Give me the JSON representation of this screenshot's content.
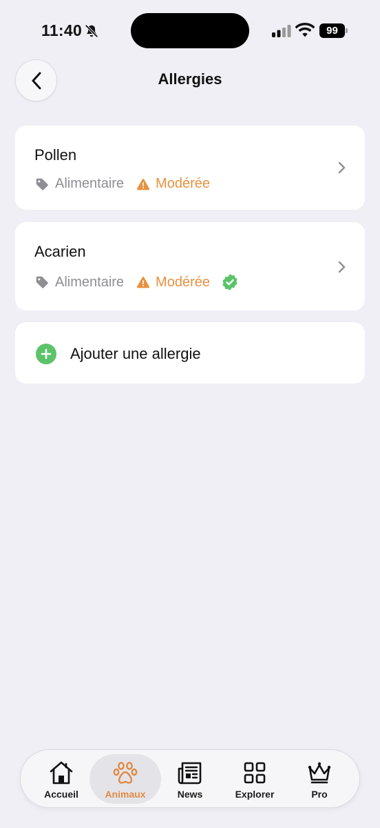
{
  "status_bar": {
    "time": "11:40",
    "battery": "99"
  },
  "header": {
    "title": "Allergies"
  },
  "allergies": [
    {
      "name": "Pollen",
      "type": "Alimentaire",
      "severity": "Modérée",
      "verified": false
    },
    {
      "name": "Acarien",
      "type": "Alimentaire",
      "severity": "Modérée",
      "verified": true
    }
  ],
  "add_action": {
    "label": "Ajouter une allergie"
  },
  "tab_bar": {
    "tabs": [
      {
        "label": "Accueil",
        "icon": "home-icon",
        "active": false
      },
      {
        "label": "Animaux",
        "icon": "paw-icon",
        "active": true
      },
      {
        "label": "News",
        "icon": "newspaper-icon",
        "active": false
      },
      {
        "label": "Explorer",
        "icon": "grid-icon",
        "active": false
      },
      {
        "label": "Pro",
        "icon": "crown-icon",
        "active": false
      }
    ]
  },
  "colors": {
    "background": "#F0EFF5",
    "severity": "#E8913F",
    "accent_active_tab": "#E08A45",
    "success": "#5CC36A",
    "muted_text": "#8E8E93"
  }
}
